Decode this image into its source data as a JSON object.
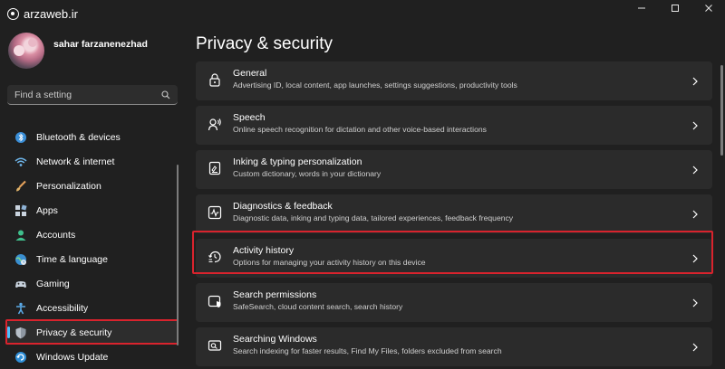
{
  "window": {
    "watermark": "arzaweb.ir"
  },
  "sidebar": {
    "user_name": "sahar farzanenezhad",
    "search_placeholder": "Find a setting",
    "items": [
      {
        "label": "Bluetooth & devices",
        "icon": "bluetooth-icon"
      },
      {
        "label": "Network & internet",
        "icon": "wifi-icon"
      },
      {
        "label": "Personalization",
        "icon": "brush-icon"
      },
      {
        "label": "Apps",
        "icon": "apps-icon"
      },
      {
        "label": "Accounts",
        "icon": "person-icon"
      },
      {
        "label": "Time & language",
        "icon": "globe-clock-icon"
      },
      {
        "label": "Gaming",
        "icon": "gamepad-icon"
      },
      {
        "label": "Accessibility",
        "icon": "accessibility-icon"
      },
      {
        "label": "Privacy & security",
        "icon": "shield-icon",
        "active": true
      },
      {
        "label": "Windows Update",
        "icon": "update-icon"
      }
    ]
  },
  "main": {
    "title": "Privacy & security",
    "cards": [
      {
        "title": "General",
        "desc": "Advertising ID, local content, app launches, settings suggestions, productivity tools",
        "icon": "lock-icon"
      },
      {
        "title": "Speech",
        "desc": "Online speech recognition for dictation and other voice-based interactions",
        "icon": "speech-icon"
      },
      {
        "title": "Inking & typing personalization",
        "desc": "Custom dictionary, words in your dictionary",
        "icon": "inking-icon"
      },
      {
        "title": "Diagnostics & feedback",
        "desc": "Diagnostic data, inking and typing data, tailored experiences, feedback frequency",
        "icon": "diagnostics-icon"
      },
      {
        "title": "Activity history",
        "desc": "Options for managing your activity history on this device",
        "icon": "history-icon",
        "highlighted": true
      },
      {
        "title": "Search permissions",
        "desc": "SafeSearch, cloud content search, search history",
        "icon": "search-permissions-icon"
      },
      {
        "title": "Searching Windows",
        "desc": "Search indexing for faster results, Find My Files, folders excluded from search",
        "icon": "searching-windows-icon"
      }
    ]
  },
  "colors": {
    "background": "#202020",
    "card": "#2b2b2b",
    "accent": "#4cc2ff",
    "highlight": "#d9232d"
  }
}
